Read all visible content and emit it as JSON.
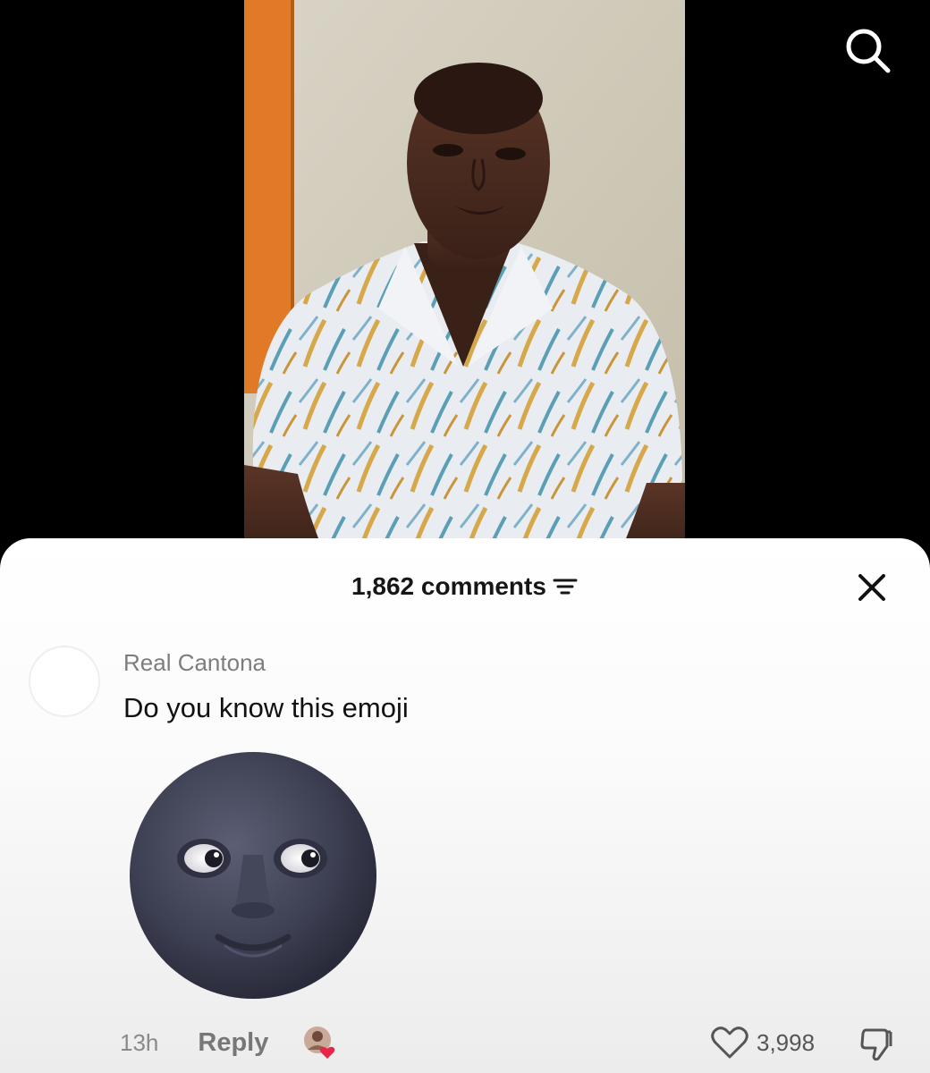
{
  "video": {
    "search_icon": "search-icon"
  },
  "comments_panel": {
    "count_label": "1,862 comments",
    "filter_icon": "filter-icon",
    "close_icon": "close-icon"
  },
  "comment": {
    "username": "Real Cantona",
    "text": "Do you know this emoji",
    "attachment": "new-moon-face-emoji",
    "time": "13h",
    "reply_label": "Reply",
    "like_count": "3,998",
    "liked_by_creator": true
  },
  "colors": {
    "sheet_bg": "#ffffff",
    "username": "#7d7d7d",
    "text": "#111111",
    "like_heart": "#e8264a"
  }
}
